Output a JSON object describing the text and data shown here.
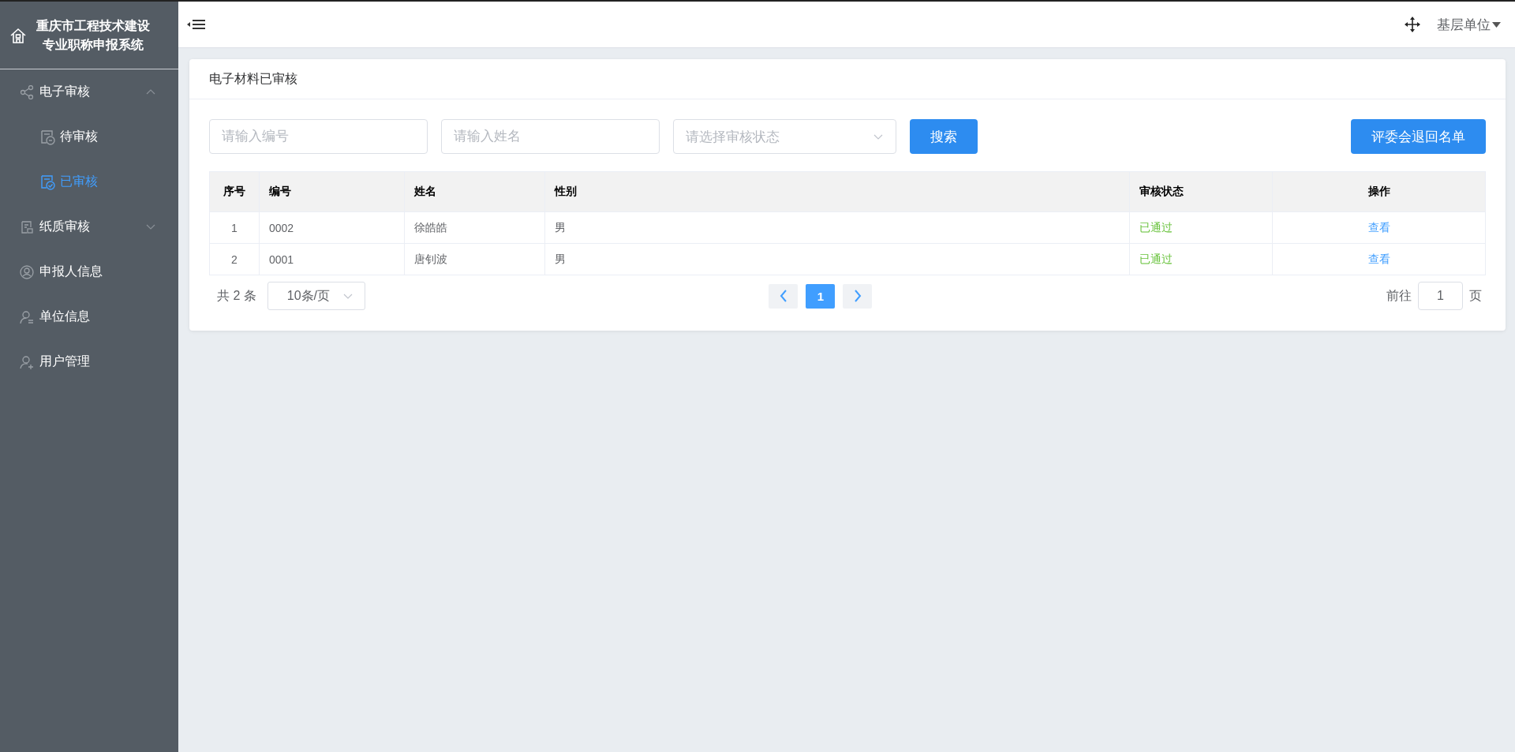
{
  "sidebar": {
    "title_lines": [
      "重庆市工程技术建设",
      "专业职称申报系统"
    ],
    "menu": [
      {
        "label": "电子审核",
        "selected": false,
        "expanded": true,
        "children": [
          {
            "label": "待审核",
            "selected": false
          },
          {
            "label": "已审核",
            "selected": true
          }
        ]
      },
      {
        "label": "纸质审核",
        "selected": false,
        "expanded": false
      },
      {
        "label": "申报人信息",
        "selected": false
      },
      {
        "label": "单位信息",
        "selected": false
      },
      {
        "label": "用户管理",
        "selected": false
      }
    ]
  },
  "header": {
    "user_menu": "基层单位"
  },
  "card": {
    "title": "电子材料已审核",
    "filters": [
      {
        "kind": "input",
        "placeholder": "请输入编号"
      },
      {
        "kind": "input",
        "placeholder": "请输入姓名"
      },
      {
        "kind": "select",
        "placeholder": "请选择审核状态"
      }
    ],
    "search_button": "搜索",
    "return_list_button": "评委会退回名单",
    "table": {
      "columns": [
        {
          "label": "序号",
          "kind": "index"
        },
        {
          "label": "编号",
          "kind": "text"
        },
        {
          "label": "姓名",
          "kind": "text"
        },
        {
          "label": "性别",
          "kind": "text"
        },
        {
          "label": "审核状态",
          "kind": "status"
        },
        {
          "label": "操作",
          "kind": "link"
        }
      ],
      "rows": [
        [
          "1",
          "0002",
          "徐皓皓",
          "男",
          "已通过",
          "查看"
        ],
        [
          "2",
          "0001",
          "唐钊波",
          "男",
          "已通过",
          "查看"
        ]
      ]
    },
    "pagination": {
      "total": "共 2 条",
      "page_size": "10条/页",
      "pages": [
        {
          "label": "1",
          "selected": true
        }
      ],
      "goto_label": "前往",
      "goto_value": "1",
      "goto_suffix": "页"
    }
  }
}
